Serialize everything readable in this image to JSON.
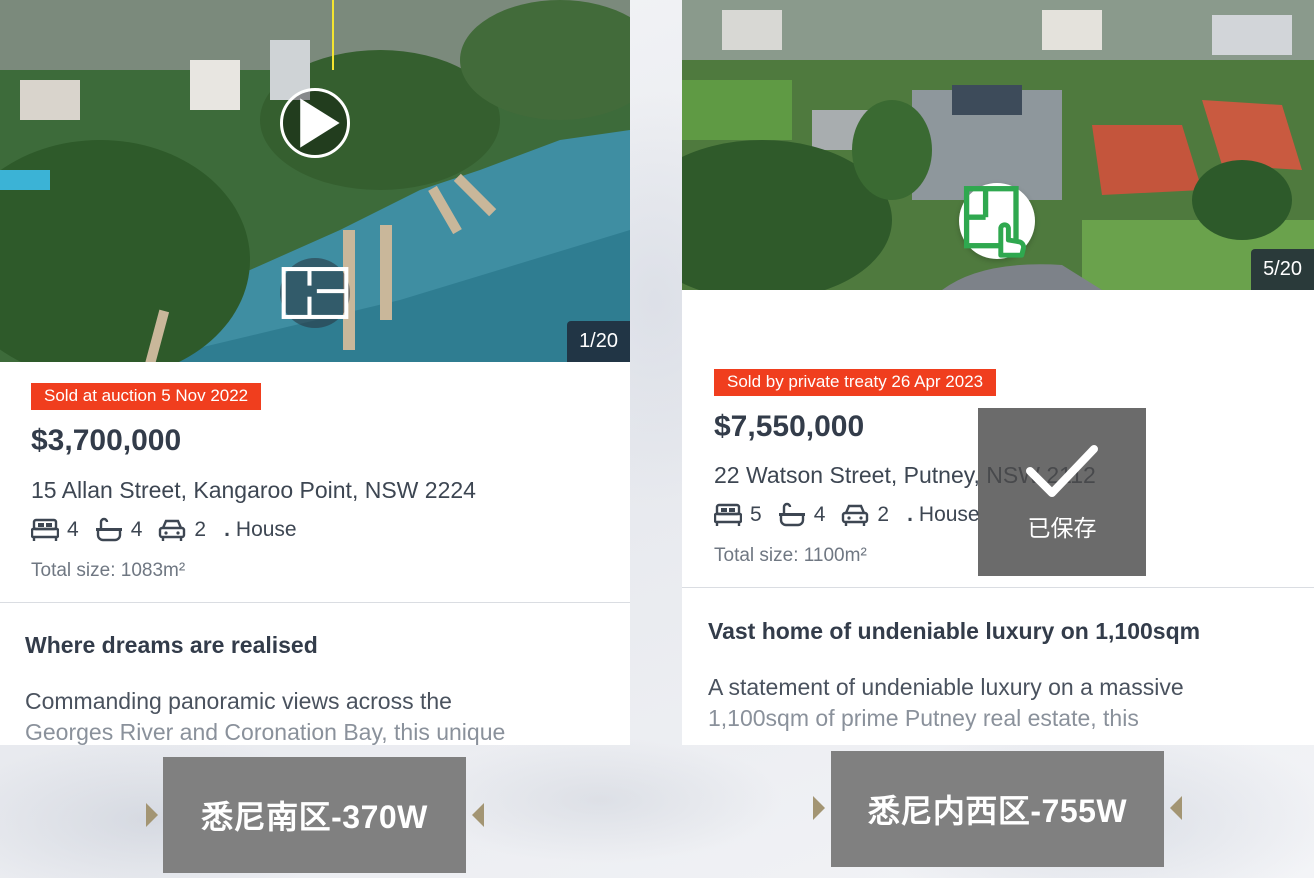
{
  "listings": [
    {
      "photo_counter": "1/20",
      "sold_label": "Sold at auction 5 Nov 2022",
      "price": "$3,700,000",
      "address": "15 Allan Street, Kangaroo Point, NSW 2224",
      "beds": "4",
      "baths": "4",
      "cars": "2",
      "property_type": "House",
      "total_size": "Total size: 1083m²",
      "headline": "Where dreams are realised",
      "description_lines": [
        "Commanding panoramic views across the",
        "Georges River and Coronation Bay, this unique"
      ]
    },
    {
      "photo_counter": "5/20",
      "sold_label": "Sold by private treaty 26 Apr 2023",
      "price": "$7,550,000",
      "address": "22 Watson Street, Putney, NSW 2112",
      "beds": "5",
      "baths": "4",
      "cars": "2",
      "property_type": "House",
      "total_size": "Total size: 1100m²",
      "headline": "Vast home of undeniable luxury on 1,100sqm",
      "description_lines": [
        "A statement of undeniable luxury on a massive",
        "1,100sqm of prime Putney real estate, this"
      ]
    }
  ],
  "saved_overlay": {
    "text": "已保存"
  },
  "region_labels": [
    {
      "text": "悉尼南区-370W"
    },
    {
      "text": "悉尼内西区-755W"
    }
  ],
  "colors": {
    "sold_badge": "#f03e1e",
    "price_text": "#333c4a",
    "region_label_bg": "#808080",
    "arrow_gold": "#a39573",
    "tour_icon_green": "#2fa84f"
  },
  "icons": [
    "play-icon",
    "floorplan-icon",
    "virtual-tour-icon",
    "bed-icon",
    "bath-icon",
    "car-icon",
    "checkmark-icon"
  ]
}
